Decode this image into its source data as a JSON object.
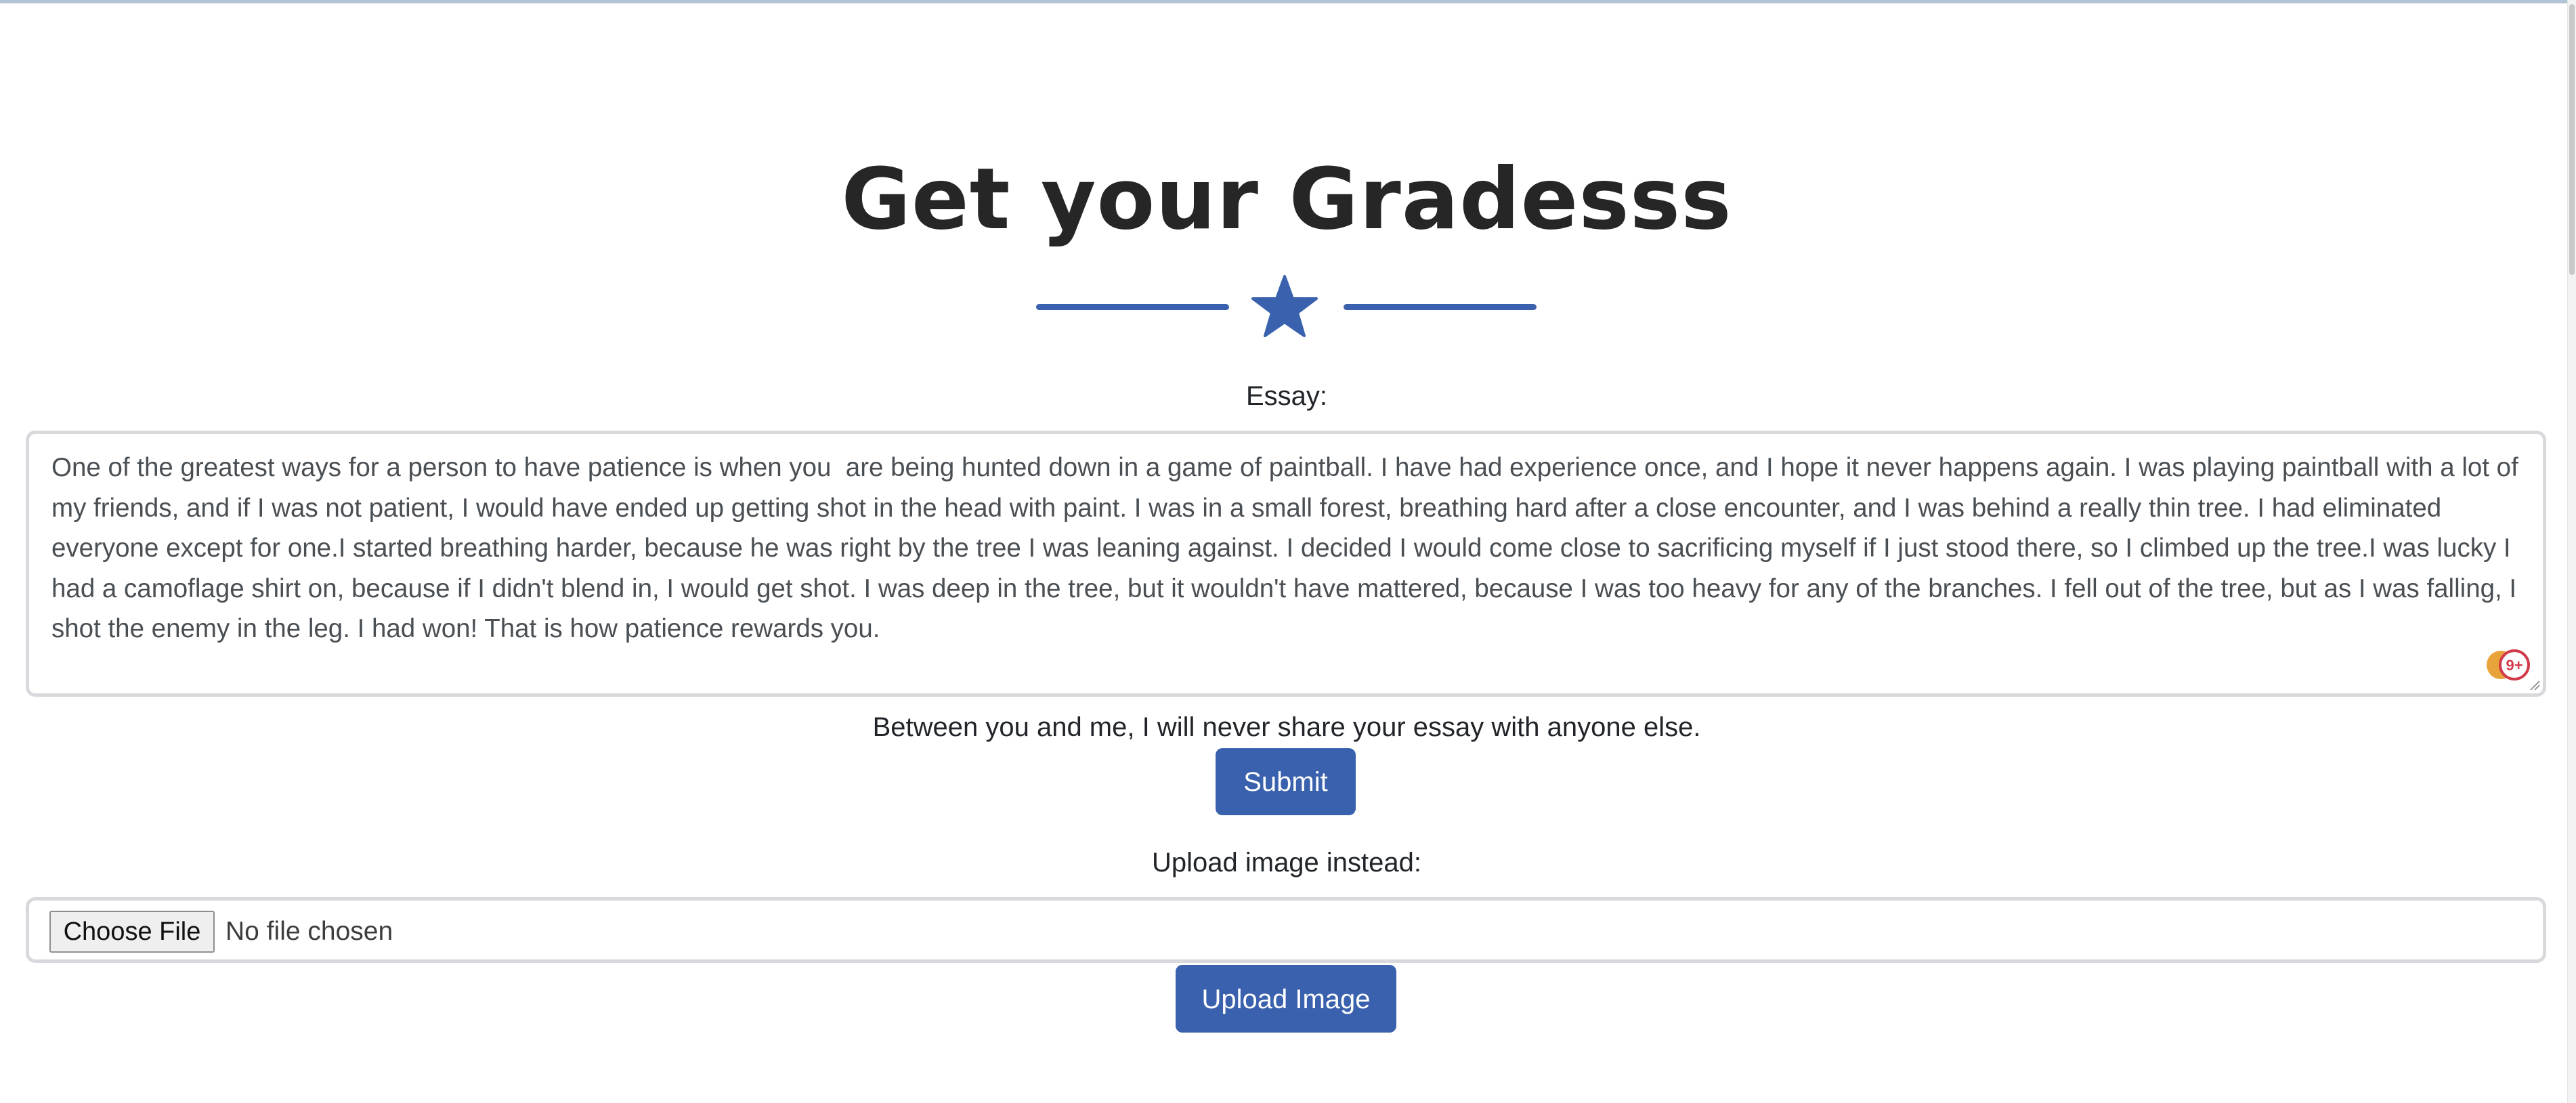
{
  "page": {
    "title": "Get your Gradesss",
    "divider_icon": "star-icon",
    "accent_color": "#3a61ad"
  },
  "essay": {
    "label": "Essay:",
    "value": "One of the greatest ways for a person to have patience is when you  are being hunted down in a game of paintball. I have had experience once, and I hope it never happens again. I was playing paintball with a lot of my friends, and if I was not patient, I would have ended up getting shot in the head with paint. I was in a small forest, breathing hard after a close encounter, and I was behind a really thin tree. I had eliminated everyone except for one.I started breathing harder, because he was right by the tree I was leaning against. I decided I would come close to sacrificing myself if I just stood there, so I climbed up the tree.I was lucky I had a camoflage shirt on, because if I didn't blend in, I would get shot. I was deep in the tree, but it wouldn't have mattered, because I was too heavy for any of the branches. I fell out of the tree, but as I was falling, I shot the enemy in the leg. I had won! That is how patience rewards you.",
    "grammar_badge": "9+",
    "privacy_note": "Between you and me, I will never share your essay with anyone else."
  },
  "submit": {
    "label": "Submit"
  },
  "upload": {
    "label": "Upload image instead:",
    "choose_file_label": "Choose File",
    "file_status": "No file chosen",
    "button_label": "Upload Image"
  }
}
